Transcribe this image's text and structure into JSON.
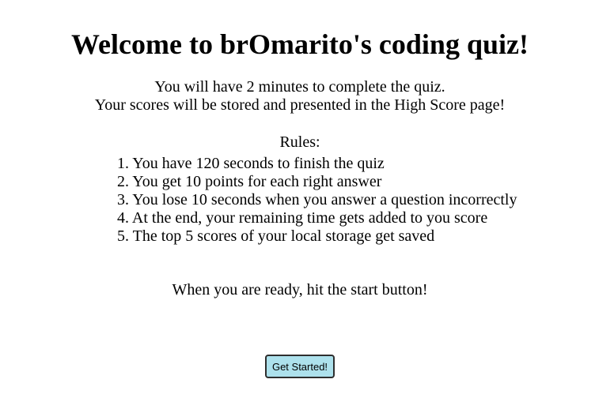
{
  "header": {
    "title": "Welcome to brOmarito's coding quiz!"
  },
  "intro": {
    "line1": "You will have 2 minutes to complete the quiz.",
    "line2": "Your scores will be stored and presented in the High Score page!"
  },
  "rules": {
    "heading": "Rules:",
    "items": [
      "1. You have 120 seconds to finish the quiz",
      "2. You get 10 points for each right answer",
      "3. You lose 10 seconds when you answer a question incorrectly",
      "4. At the end, your remaining time gets added to you score",
      "5. The top 5 scores of your local storage get saved"
    ]
  },
  "ready": {
    "text": "When you are ready, hit the start button!"
  },
  "start": {
    "label": "Get Started!"
  },
  "colors": {
    "background": "#ffffff",
    "text": "#000000",
    "button_background": "#ade1ec",
    "button_border": "#2e2e2e"
  }
}
